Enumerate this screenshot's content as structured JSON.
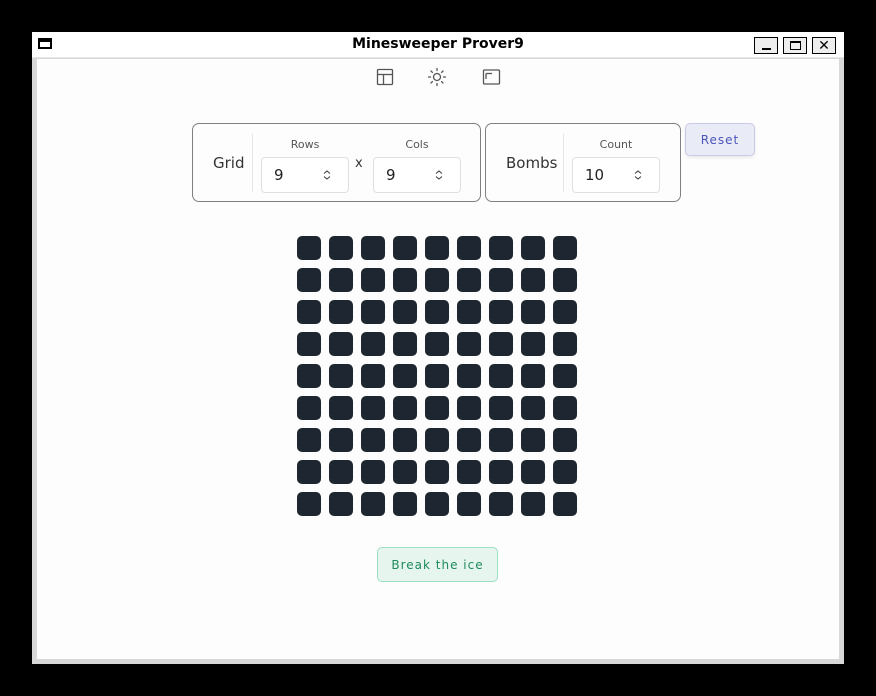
{
  "window": {
    "title": "Minesweeper Prover9"
  },
  "toolbar": {
    "icons": [
      "layout-icon",
      "sun-icon",
      "panel-icon"
    ]
  },
  "grid_card": {
    "label": "Grid",
    "rows_label": "Rows",
    "rows_value": "9",
    "separator": "x",
    "cols_label": "Cols",
    "cols_value": "9"
  },
  "bombs_card": {
    "label": "Bombs",
    "count_label": "Count",
    "count_value": "10"
  },
  "reset_button": {
    "label": "Reset",
    "color": "#4b55b8"
  },
  "board": {
    "rows": 9,
    "cols": 9,
    "cell_color": "#1e2632"
  },
  "break_button": {
    "label": "Break the ice",
    "color": "#1f8a5a"
  }
}
